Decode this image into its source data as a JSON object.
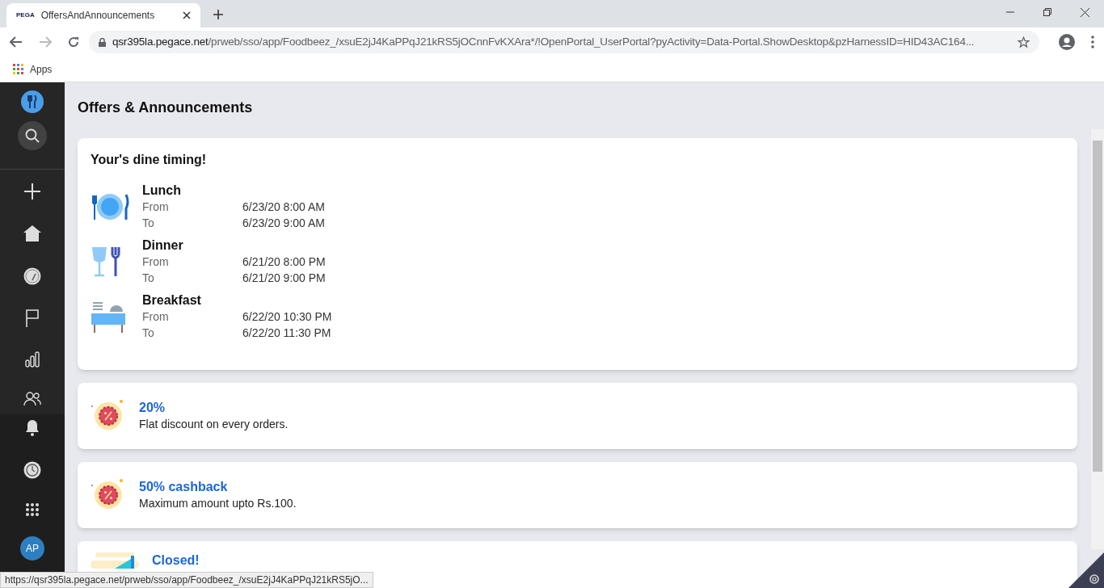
{
  "browser": {
    "tab_title": "OffersAndAnnouncements",
    "tab_favicon": "PEGA",
    "url_host": "qsr395la.pegace.net",
    "url_path": "/prweb/sso/app/Foodbeez_/xsuE2jJ4KaPPqJ21kRS5jOCnnFvKXAra*/!OpenPortal_UserPortal?pyActivity=Data-Portal.ShowDesktop&pzHarnessID=HID43AC164...",
    "bookmarks": [
      "Apps"
    ]
  },
  "sidebar": {
    "avatar": "AP"
  },
  "page_title": "Offers & Announcements",
  "dine_card": {
    "title": "Your's dine timing!",
    "meals": [
      {
        "kind": "lunch",
        "name": "Lunch",
        "from_label": "From",
        "from": "6/23/20 8:00 AM",
        "to_label": "To",
        "to": "6/23/20 9:00 AM"
      },
      {
        "kind": "dinner",
        "name": "Dinner",
        "from_label": "From",
        "from": "6/21/20 8:00 PM",
        "to_label": "To",
        "to": "6/21/20 9:00 PM"
      },
      {
        "kind": "breakfast",
        "name": "Breakfast",
        "from_label": "From",
        "from": "6/22/20 10:30 PM",
        "to_label": "To",
        "to": "6/22/20 11:30 PM"
      }
    ]
  },
  "offers": [
    {
      "kind": "discount",
      "title": "20%",
      "description": "Flat discount on every orders."
    },
    {
      "kind": "discount",
      "title": "50% cashback",
      "description": "Maximum amount upto Rs.100."
    },
    {
      "kind": "closed",
      "title": "Closed!"
    }
  ],
  "status_bar": "https://qsr395la.pegace.net/prweb/sso/app/Foodbeez_/xsuE2jJ4KaPPqJ21kRS5jO..."
}
